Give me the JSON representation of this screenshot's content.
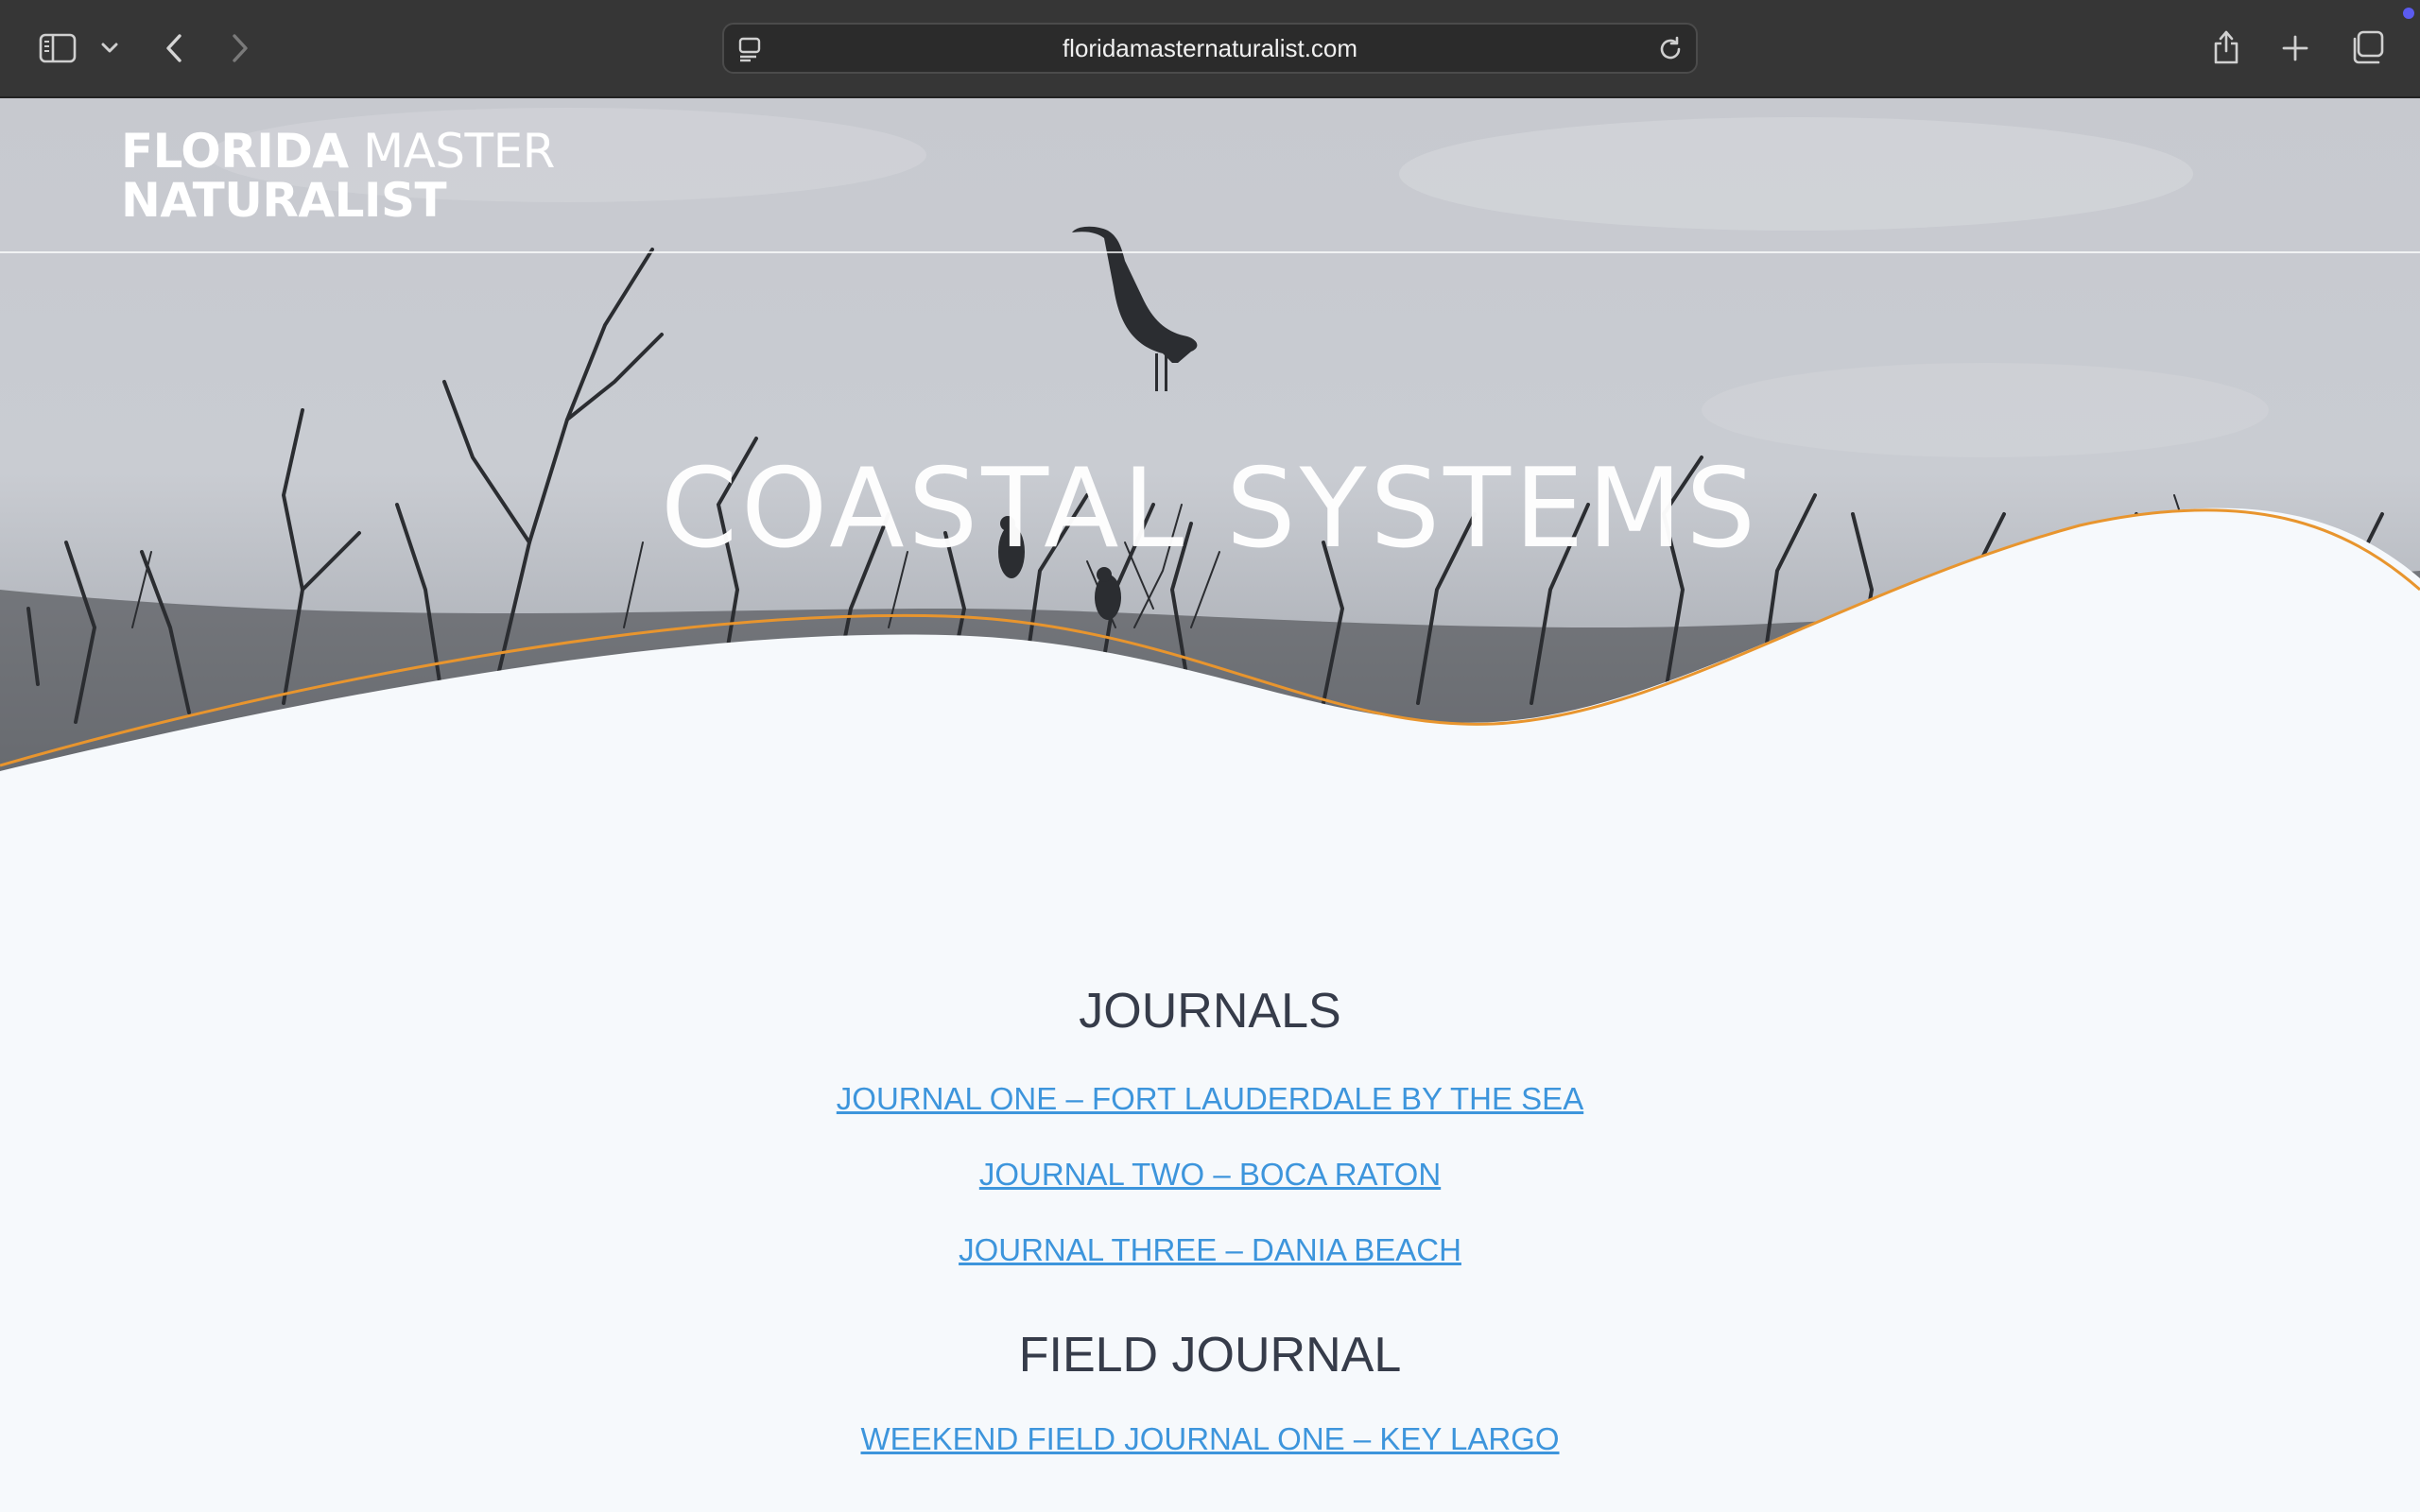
{
  "browser": {
    "url": "floridamasternaturalist.com",
    "icons": [
      "sidebar-icon",
      "chevron-down-icon",
      "back-icon",
      "forward-icon",
      "site-settings-icon",
      "reload-icon",
      "share-icon",
      "new-tab-icon",
      "tabs-overview-icon"
    ]
  },
  "site": {
    "logo_line1_bold": "FLORIDA",
    "logo_line1_light": " MASTER",
    "logo_line2": "NATURALIST"
  },
  "hero": {
    "title": "COASTAL SYSTEMS"
  },
  "sections": [
    {
      "heading": "JOURNALS",
      "links": [
        "JOURNAL ONE – FORT LAUDERDALE BY THE SEA",
        "JOURNAL TWO – BOCA RATON",
        "JOURNAL THREE – DANIA BEACH"
      ]
    },
    {
      "heading": "FIELD JOURNAL",
      "links": [
        "WEEKEND FIELD JOURNAL ONE – KEY LARGO"
      ]
    }
  ],
  "colors": {
    "accent_orange": "#e8952e",
    "link_blue": "#3d95dc",
    "heading": "#363c4a",
    "page_bg": "#f6f9fc"
  }
}
